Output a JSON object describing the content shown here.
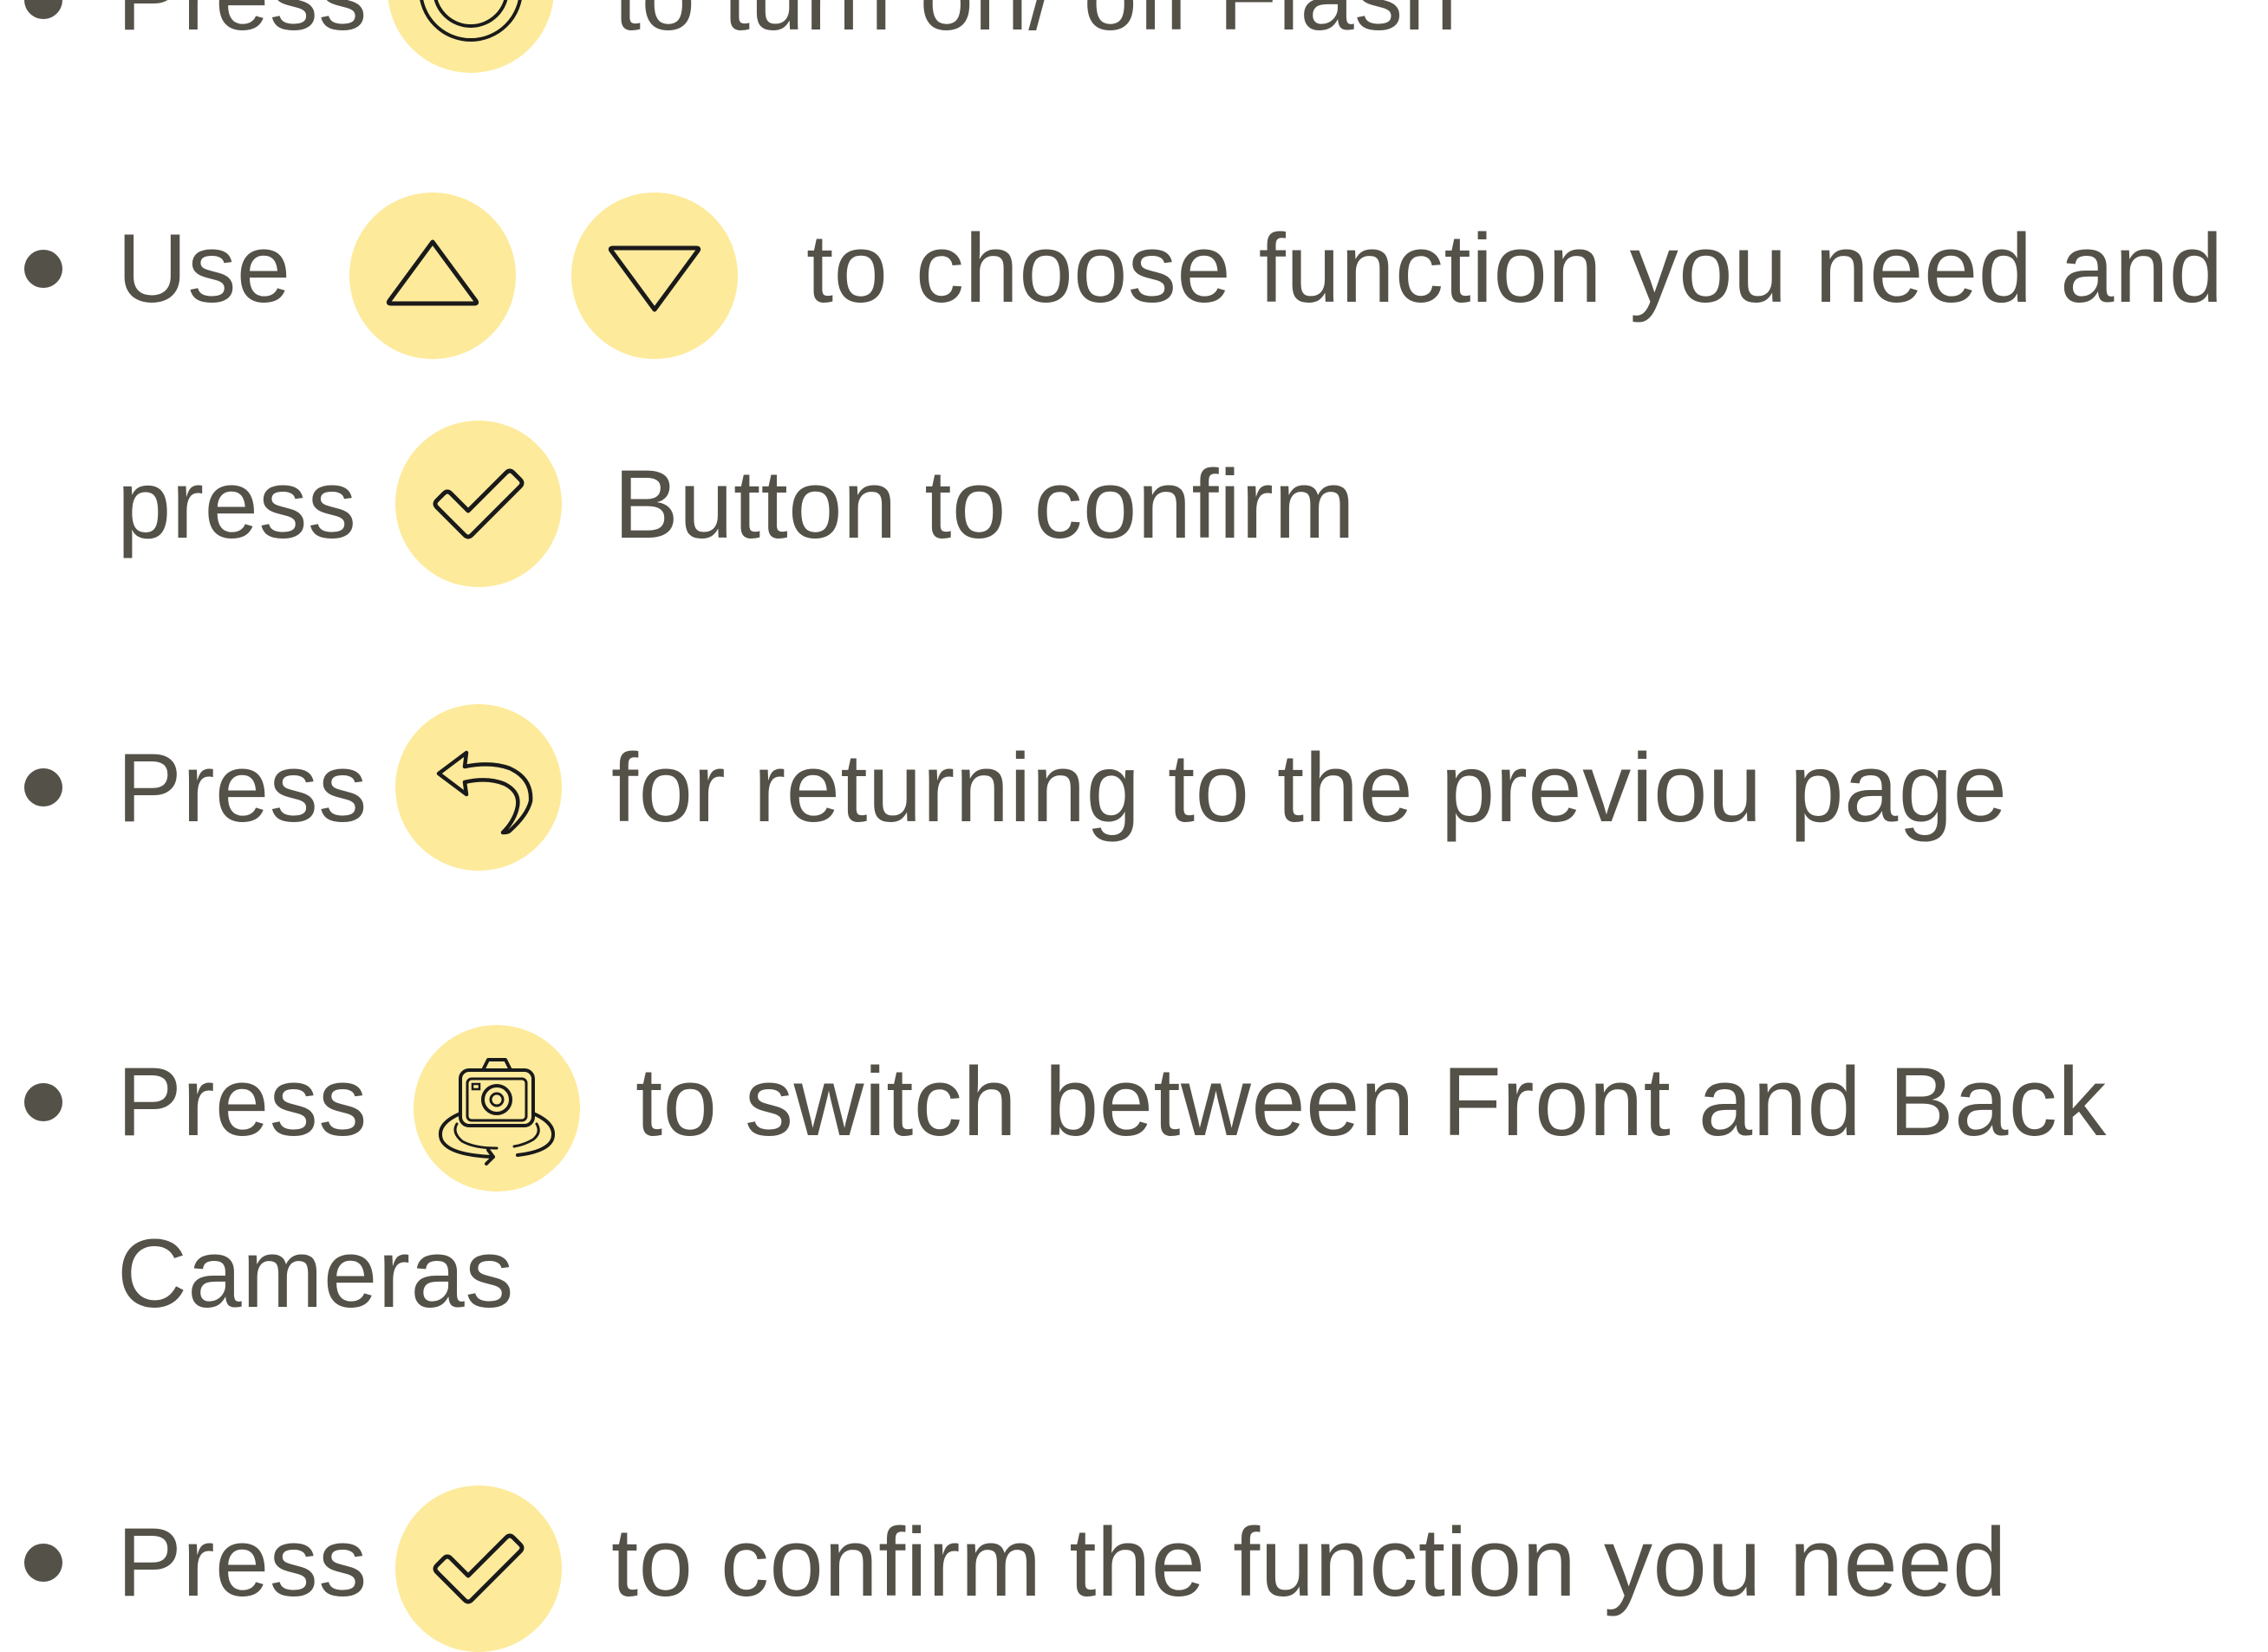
{
  "colors": {
    "text": "#545148",
    "icon_circle": "#FDEA9B",
    "icon_stroke": "#1a1a1a"
  },
  "items": [
    {
      "prefix": "Press",
      "icon": "flash-button-icon",
      "suffix": "to turn on/ off Flash"
    },
    {
      "prefix": "Use",
      "icons": [
        "up-triangle-icon",
        "down-triangle-icon"
      ],
      "suffix": "to choose function you need and",
      "continuation_prefix": "press",
      "continuation_icon": "check-icon",
      "continuation_suffix": "Button to confirm"
    },
    {
      "prefix": "Press",
      "icon": "return-arrow-icon",
      "suffix": "for returning to the previou page"
    },
    {
      "prefix": "Press",
      "icon": "camera-switch-icon",
      "suffix": "to switch between Front and Back",
      "continuation": "Cameras"
    },
    {
      "prefix": "Press",
      "icon": "check-icon",
      "suffix": "to confirm the function you need"
    }
  ]
}
